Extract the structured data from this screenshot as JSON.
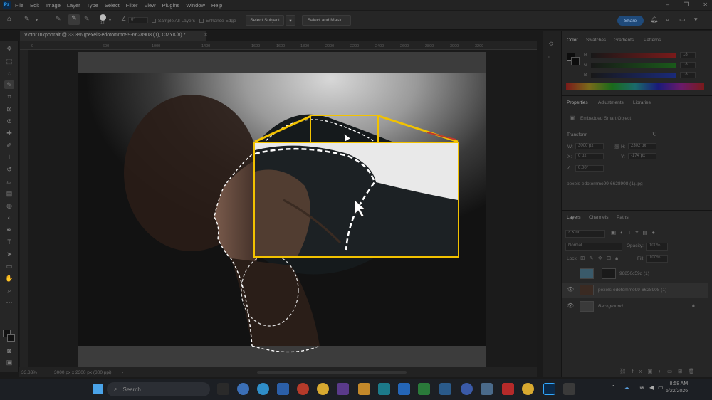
{
  "app": {
    "logo": "Ps",
    "menu": [
      "File",
      "Edit",
      "Image",
      "Layer",
      "Type",
      "Select",
      "Filter",
      "View",
      "Plugins",
      "Window",
      "Help"
    ]
  },
  "options_bar": {
    "angle": "0°",
    "brush_size": "18",
    "sample_all_layers": "Sample All Layers",
    "enhance_edge": "Enhance Edge",
    "select_subject": "Select Subject",
    "select_and_mask": "Select and Mask...",
    "share": "Share"
  },
  "document": {
    "tab_title": "Victor Inkportrait @ 33.3% (pexels-edotommo99-6628908 (1), CMYK/8) *",
    "close": "×"
  },
  "ruler": {
    "ticks": [
      "0",
      "200",
      "400",
      "600",
      "800",
      "1000",
      "1200",
      "1400",
      "1600",
      "1800",
      "2000",
      "2200",
      "2400",
      "2600",
      "2800",
      "3000",
      "3200"
    ]
  },
  "status_bar": {
    "zoom": "33.33%",
    "doc_size": "3000 px x 2300 px (300 ppi)"
  },
  "color_panel": {
    "tabs": [
      "Color",
      "Swatches",
      "Gradients",
      "Patterns"
    ],
    "channels": [
      {
        "label": "R",
        "value": "18"
      },
      {
        "label": "G",
        "value": "18"
      },
      {
        "label": "B",
        "value": "18"
      }
    ]
  },
  "properties_panel": {
    "tabs": [
      "Properties",
      "Adjustments",
      "Libraries"
    ],
    "object_type": "Embedded Smart Object",
    "transform_label": "Transform",
    "w_label": "W:",
    "w_value": "3000 px",
    "h_label": "H:",
    "h_value": "2302 px",
    "x_label": "X:",
    "x_value": "0 px",
    "y_label": "Y:",
    "y_value": "-174 px",
    "angle_value": "0.00°",
    "linked_file": "pexels-edotommo99-6628908 (1).jpg"
  },
  "layers_panel": {
    "tabs": [
      "Layers",
      "Channels",
      "Paths"
    ],
    "filter_kind": "Kind",
    "blend_mode": "Normal",
    "opacity_label": "Opacity:",
    "opacity_value": "100%",
    "lock_label": "Lock:",
    "fill_label": "Fill:",
    "fill_value": "100%",
    "layers": [
      {
        "name": "96850c59d (1)"
      },
      {
        "name": "pexels-edotommo99-6628908 (1)"
      },
      {
        "name": "Background"
      }
    ]
  },
  "taskbar": {
    "search_placeholder": "Search",
    "time": "8:58 AM",
    "date": "5/22/2026"
  },
  "colors": {
    "callout": "#f2c200",
    "accent_blue": "#1f4a7a"
  }
}
